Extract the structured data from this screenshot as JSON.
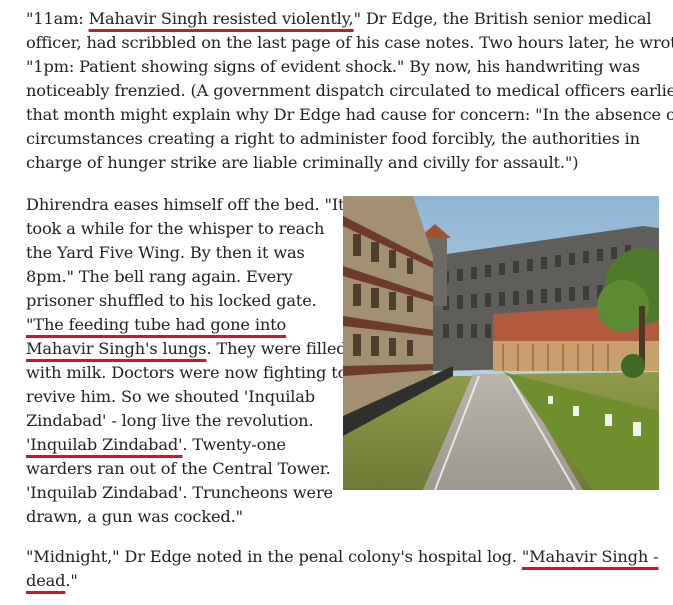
{
  "article": {
    "para1": {
      "l1": {
        "a": "\"11am: ",
        "hl": "Mahavir Singh resisted violently,",
        "b": "\" Dr Edge, the British senior medical"
      },
      "l2": "officer, had scribbled on the last page of his case notes. Two hours later, he wrote,",
      "l3": "\"1pm: Patient showing signs of evident shock.\" By now, his handwriting was",
      "l4": "noticeably frenzied. (A government dispatch circulated to medical officers earlier",
      "l5": "that month might explain why Dr Edge had cause for concern: \"In the absence of",
      "l6": "circumstances creating a right to administer food forcibly, the authorities in",
      "l7": "charge of hunger strike are liable criminally and civilly for assault.\")"
    },
    "para2": {
      "l1": "Dhirendra eases himself off the bed. \"It",
      "l2": "took a while for the whisper to reach",
      "l3": "the Yard Five Wing. By then it was",
      "l4": "8pm.\" The bell rang again. Every",
      "l5": "prisoner shuffled to his locked gate.",
      "l6": {
        "hl": "\"The feeding tube had gone into"
      },
      "l7": {
        "hl": "Mahavir Singh's lungs",
        "b": ". They were filled"
      },
      "l8": "with milk. Doctors were now fighting to",
      "l9": "revive him. So we shouted 'Inquilab",
      "l10": "Zindabad' - long live the revolution.",
      "l11": {
        "hl": "'Inquilab Zindabad'",
        "b": ". Twenty-one"
      },
      "l12": "warders ran out of the Central Tower.",
      "l13": "'Inquilab Zindabad'. Truncheons were",
      "l14": "drawn, a gun was cocked.\""
    },
    "para3": {
      "l1": {
        "a": "\"Midnight,\" Dr Edge noted in the penal colony's hospital log. ",
        "hl": "\"Mahavir Singh -"
      },
      "l2": {
        "hl": "dead",
        "b": ".\""
      }
    }
  },
  "colors": {
    "text": "#222222",
    "underline": "#d0142a",
    "background": "#ffffff"
  }
}
